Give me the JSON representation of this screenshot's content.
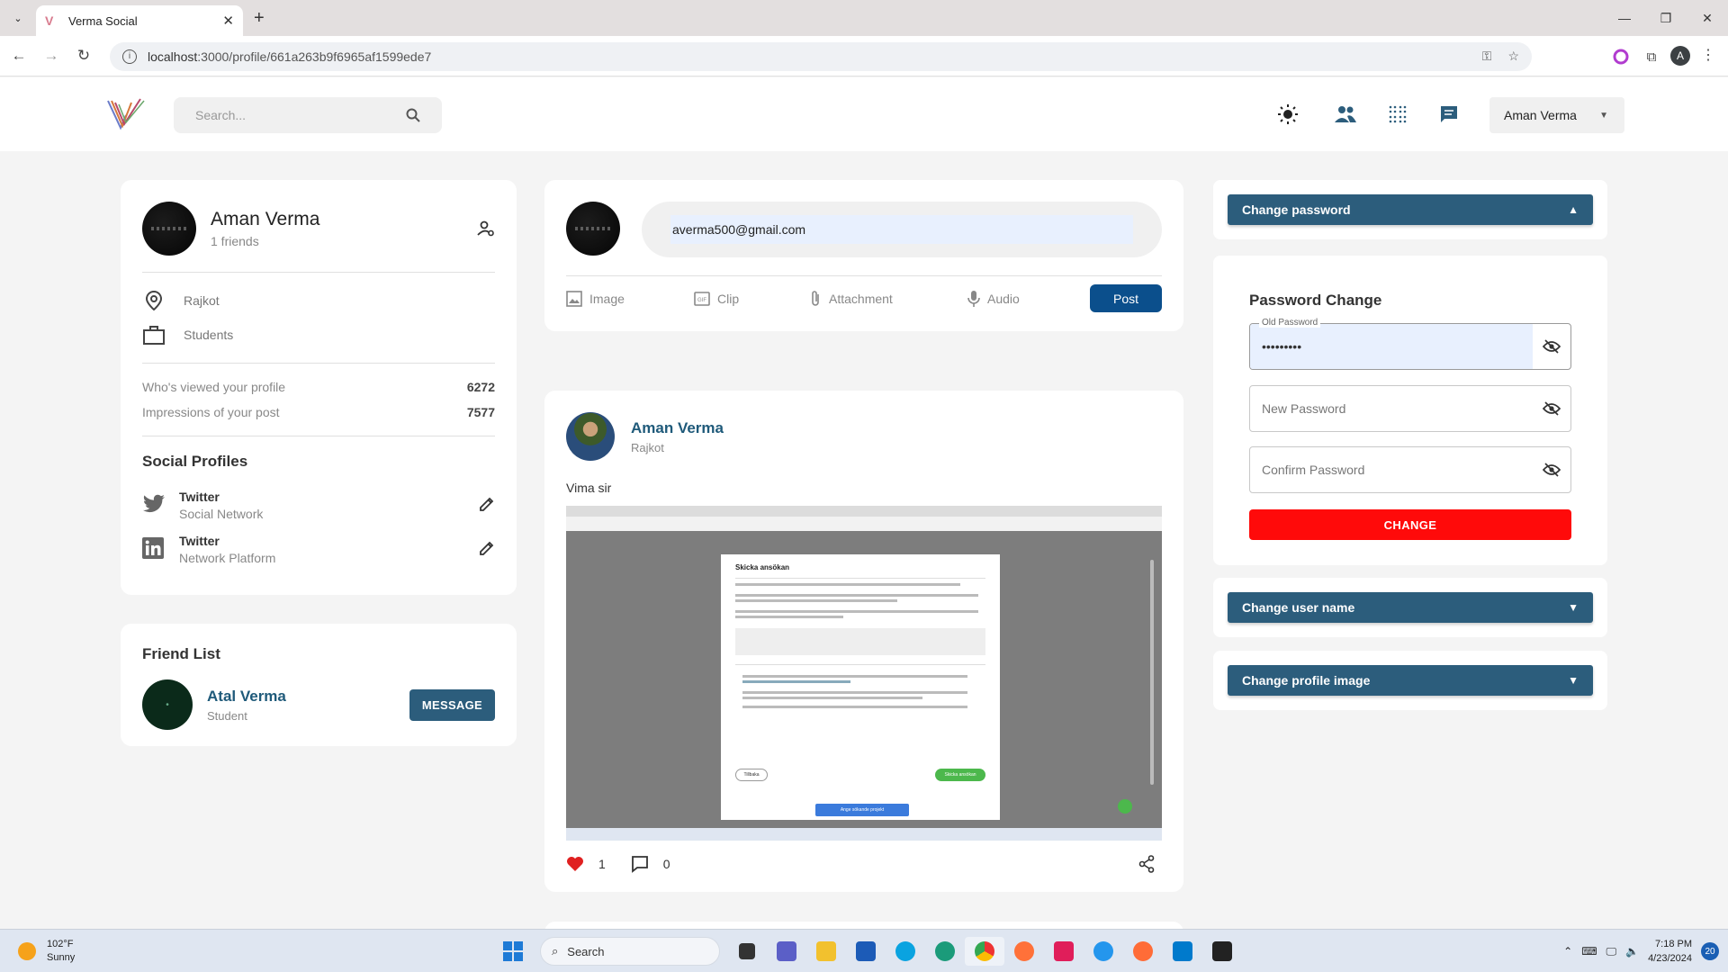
{
  "browser": {
    "tab_title": "Verma Social",
    "url_host": "localhost",
    "url_rest": ":3000/profile/661a263b9f6965af1599ede7",
    "profile_initial": "A"
  },
  "header": {
    "search_placeholder": "Search...",
    "user_name": "Aman Verma"
  },
  "profile": {
    "name": "Aman Verma",
    "friends": "1 friends",
    "location": "Rajkot",
    "occupation": "Students",
    "viewed_label": "Who's viewed your profile",
    "viewed_value": "6272",
    "impressions_label": "Impressions of your post",
    "impressions_value": "7577",
    "social_title": "Social Profiles",
    "socials": [
      {
        "name": "Twitter",
        "type": "Social Network",
        "icon": "twitter-icon"
      },
      {
        "name": "Twitter",
        "type": "Network Platform",
        "icon": "linkedin-icon"
      }
    ]
  },
  "friends": {
    "title": "Friend List",
    "items": [
      {
        "name": "Atal Verma",
        "role": "Student",
        "button": "MESSAGE"
      }
    ]
  },
  "composer": {
    "input_value": "averma500@gmail.com",
    "actions": [
      "Image",
      "Clip",
      "Attachment",
      "Audio"
    ],
    "post_label": "Post"
  },
  "post": {
    "author": "Aman Verma",
    "location": "Rajkot",
    "text": "Vima sir",
    "likes": "1",
    "comments": "0",
    "image_screenshot": {
      "dialog_title": "Skicka ansökan",
      "cancel": "Tillbaka",
      "submit": "Skicka ansökan",
      "banner": "Ange sökande projekt"
    }
  },
  "settings": {
    "change_password": "Change password",
    "password_change_title": "Password Change",
    "old_password_label": "Old Password",
    "old_password_value": "•••••••••",
    "new_password_placeholder": "New Password",
    "confirm_password_placeholder": "Confirm Password",
    "change_button": "CHANGE",
    "change_user_name": "Change user name",
    "change_profile_image": "Change profile image"
  },
  "taskbar": {
    "temp": "102°F",
    "weather": "Sunny",
    "search": "Search",
    "time": "7:18 PM",
    "date": "4/23/2024",
    "notifications": "20"
  },
  "colors": {
    "accent": "#2c5d7c",
    "post_button": "#0b4f8c",
    "danger": "#ff0a0a",
    "name_link": "#1f5a7a"
  }
}
